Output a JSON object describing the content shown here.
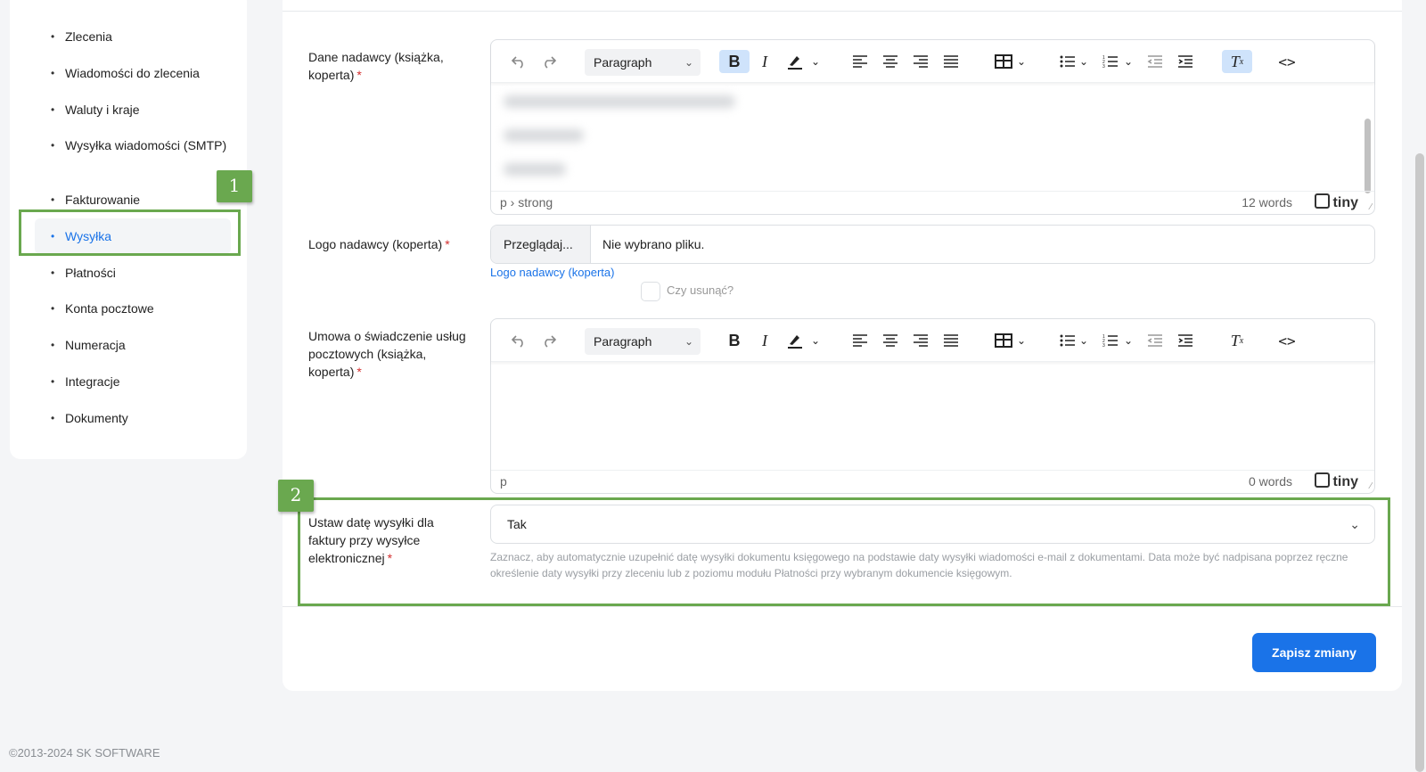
{
  "sidebar": {
    "items": [
      {
        "label": "Zlecenia"
      },
      {
        "label": "Wiadomości do zlecenia"
      },
      {
        "label": "Waluty i kraje"
      },
      {
        "label": "Wysyłka wiadomości (SMTP)"
      },
      {
        "label": "Fakturowanie"
      },
      {
        "label": "Wysyłka",
        "active": true
      },
      {
        "label": "Płatności"
      },
      {
        "label": "Konta pocztowe"
      },
      {
        "label": "Numeracja"
      },
      {
        "label": "Integracje"
      },
      {
        "label": "Dokumenty"
      }
    ]
  },
  "form": {
    "sender_data": {
      "label": "Dane nadawcy (książka, koperta)",
      "required_mark": "*",
      "toolbar": {
        "paragraph": "Paragraph"
      },
      "status_path": "p › strong",
      "word_count": "12 words",
      "brand": "tiny"
    },
    "sender_logo": {
      "label": "Logo nadawcy (koperta)",
      "required_mark": "*",
      "browse_label": "Przeglądaj...",
      "file_status": "Nie wybrano pliku.",
      "link_text": "Logo nadawcy (koperta)",
      "remove_label": "Czy usunąć?"
    },
    "postal_contract": {
      "label": "Umowa o świadczenie usług pocztowych (książka, koperta)",
      "required_mark": "*",
      "toolbar": {
        "paragraph": "Paragraph"
      },
      "status_path": "p",
      "word_count": "0 words",
      "brand": "tiny"
    },
    "shipping_date": {
      "label": "Ustaw datę wysyłki dla faktury przy wysyłce elektronicznej",
      "required_mark": "*",
      "selected": "Tak",
      "help": "Zaznacz, aby automatycznie uzupełnić datę wysyłki dokumentu księgowego na podstawie daty wysyłki wiadomości e-mail z dokumentami. Data może być nadpisana poprzez ręczne określenie daty wysyłki przy zleceniu lub z poziomu modułu Płatności przy wybranym dokumencie księgowym."
    },
    "save_label": "Zapisz zmiany"
  },
  "annotations": {
    "badge_1": "1",
    "badge_2": "2",
    "color": "#6aa84f"
  },
  "footer": {
    "copyright": "©2013-2024  SK SOFTWARE"
  },
  "colors": {
    "accent": "#1a73e8",
    "required": "#d32f2f"
  }
}
